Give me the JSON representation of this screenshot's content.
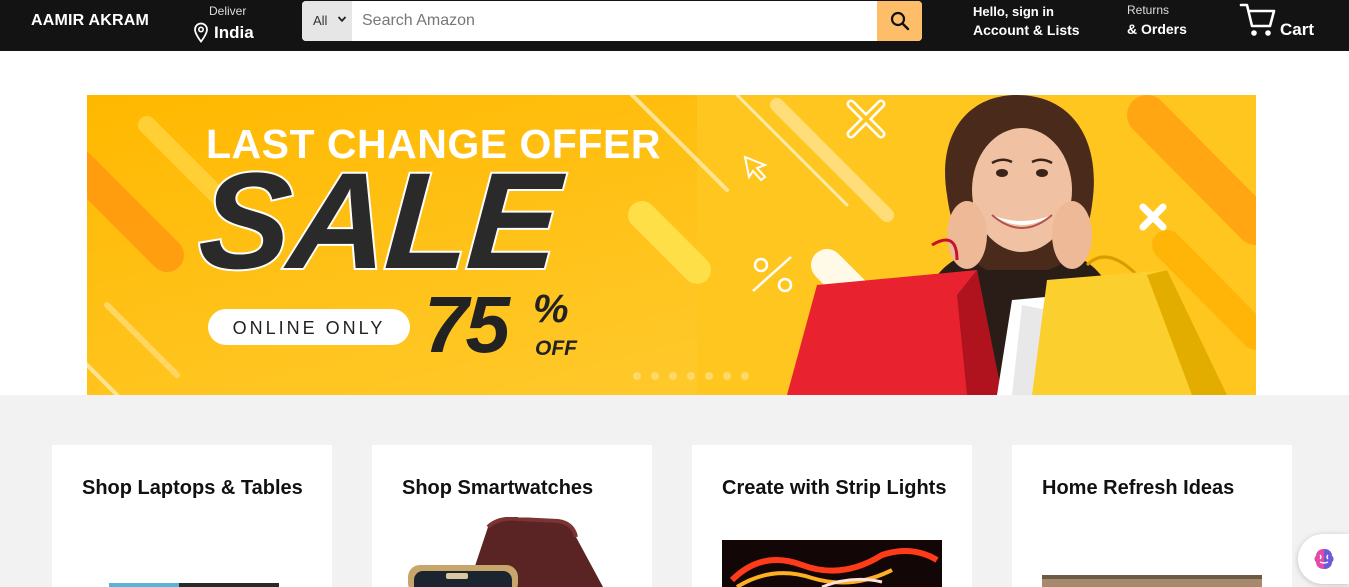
{
  "nav": {
    "logo": "AAMIR AKRAM",
    "deliver_label": "Deliver",
    "deliver_location": "India",
    "search_category": "All",
    "search_placeholder": "Search Amazon",
    "account_line1": "Hello, sign in",
    "account_line2": "Account & Lists",
    "returns_line1": "Returns",
    "returns_line2": "& Orders",
    "cart_label": "Cart",
    "icons": [
      "location-pin-icon",
      "chevron-down-icon",
      "search-icon",
      "cart-icon"
    ]
  },
  "banner": {
    "headline": "LAST CHANGE OFFER",
    "sale": "SALE",
    "pill": "ONLINE ONLY",
    "percent": "75",
    "percent_sign": "%",
    "off": "OFF",
    "colors": {
      "background": "#ffc21f",
      "accent": "#ff8a00",
      "text_dark": "#2a2a2a"
    }
  },
  "cards": [
    {
      "title": "Shop Laptops & Tables"
    },
    {
      "title": "Shop Smartwatches"
    },
    {
      "title": "Create with Strip Lights"
    },
    {
      "title": "Home Refresh Ideas"
    }
  ],
  "colors": {
    "nav_bg": "#131313",
    "search_button": "#febd69",
    "page_bg": "#f2f2f2"
  }
}
